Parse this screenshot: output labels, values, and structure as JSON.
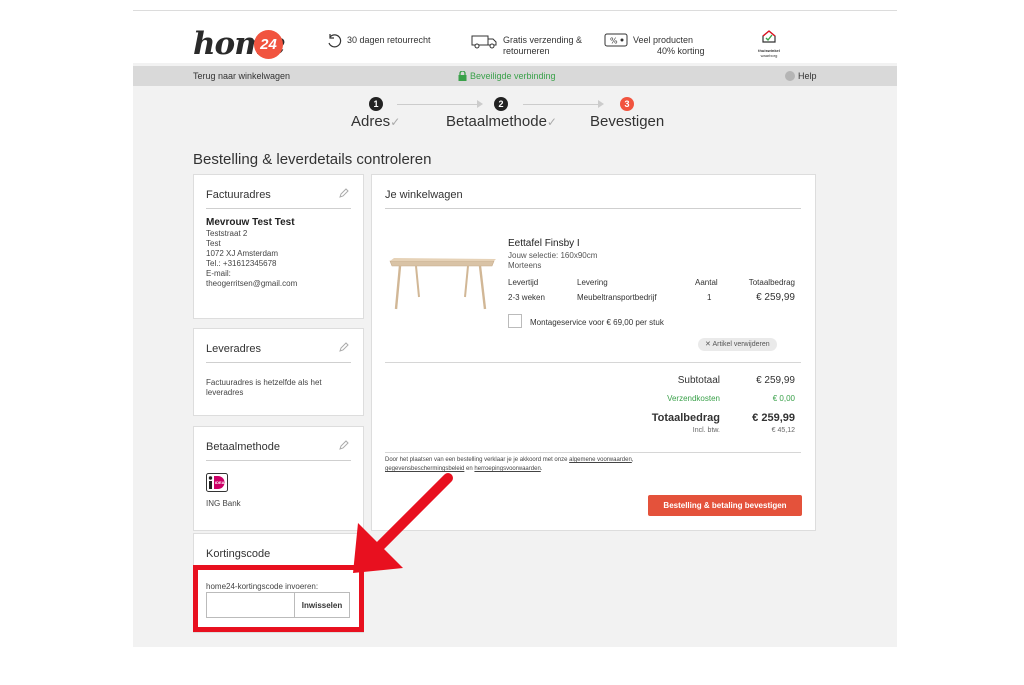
{
  "header": {
    "logo_text": "home",
    "logo_badge": "24",
    "usps": [
      {
        "icon": "return-arrow-icon",
        "text": "30 dagen retourrecht"
      },
      {
        "icon": "delivery-truck-icon",
        "text": "Gratis verzending &",
        "text2": "retourneren"
      },
      {
        "icon": "percent-tag-icon",
        "text": "Veel producten",
        "text2": "40% korting"
      }
    ],
    "seal_text": "thuiswinkel",
    "seal_sub": "waarborg"
  },
  "greybar": {
    "back_link": "Terug naar winkelwagen",
    "secure_text": "Beveiligde verbinding",
    "help": "Help"
  },
  "steps": [
    {
      "num": "1",
      "label": "Adres",
      "check": "✓"
    },
    {
      "num": "2",
      "label": "Betaalmethode",
      "check": "✓"
    },
    {
      "num": "3",
      "label": "Bevestigen",
      "check": ""
    }
  ],
  "page_title": "Bestelling & leverdetails controleren",
  "invoice": {
    "title": "Factuuradres",
    "name": "Mevrouw Test Test",
    "lines": [
      "Teststraat 2",
      "Test",
      "1072 XJ Amsterdam",
      "Tel.: +31612345678",
      "E-mail:",
      "theogerritsen@gmail.com"
    ]
  },
  "delivery": {
    "title": "Leveradres",
    "lines": [
      "Factuuradres is hetzelfde als het",
      "leveradres"
    ]
  },
  "payment": {
    "title": "Betaalmethode",
    "method": "ING Bank",
    "ideal_label": "iDEAL"
  },
  "coupon": {
    "title": "Kortingscode",
    "label": "home24-kortingscode invoeren:",
    "value": "",
    "button": "Inwisselen"
  },
  "cart": {
    "title": "Je winkelwagen",
    "product": {
      "name": "Eettafel Finsby I",
      "selection": "Jouw selectie: 160x90cm",
      "material": "Morteens",
      "headers": {
        "levertijd": "Levertijd",
        "levering": "Levering",
        "aantal": "Aantal",
        "totaal": "Totaalbedrag"
      },
      "levertijd": "2-3 weken",
      "levering": "Meubeltransportbedrijf",
      "aantal": "1",
      "totaal": "€ 259,99",
      "montage": "Montageservice voor € 69,00 per stuk",
      "remove": "Artikel verwijderen"
    },
    "summary": {
      "subtotaal_label": "Subtotaal",
      "subtotaal": "€ 259,99",
      "verzend_label": "Verzendkosten",
      "verzend": "€ 0,00",
      "totaal_label": "Totaalbedrag",
      "totaal": "€ 259,99",
      "btw_label": "Incl. btw.",
      "btw": "€ 45,12"
    },
    "legal": {
      "part1": "Door het plaatsen van een bestelling verklaar je je akkoord met onze ",
      "link1": "algemene voorwaarden",
      "part2": ",",
      "link2": "gegevensbeschermingsbeleid",
      "part3": " en ",
      "link3": "herroepingsvoorwaarden",
      "part4": "."
    },
    "confirm_button": "Bestelling & betaling bevestigen"
  },
  "colors": {
    "brand": "#f1543f",
    "secure_green": "#3aa14a",
    "highlight_red": "#e8101f"
  }
}
